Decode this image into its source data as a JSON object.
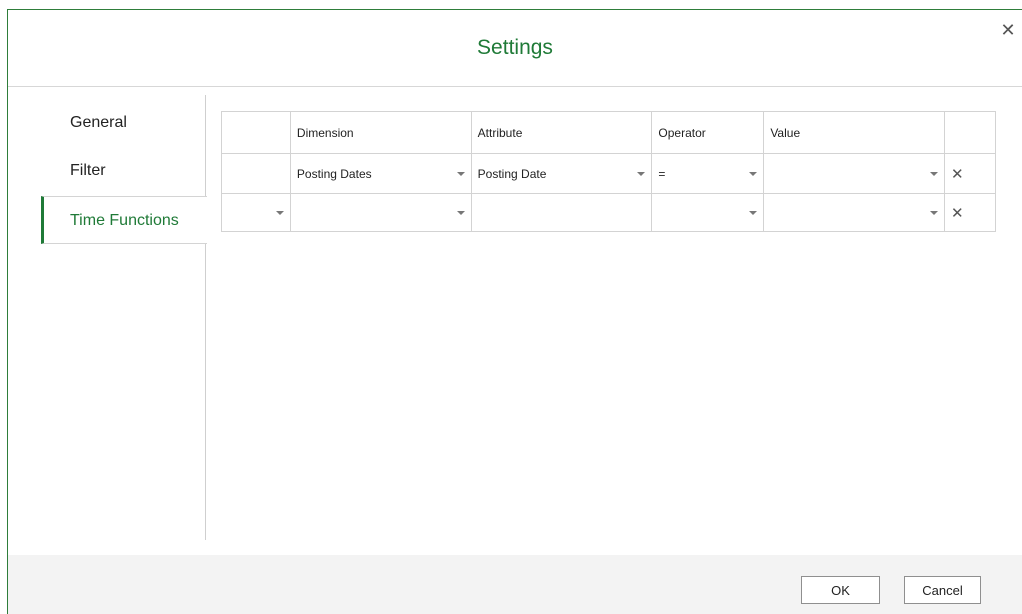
{
  "dialog": {
    "title": "Settings",
    "close_symbol": "✕"
  },
  "sidebar": {
    "tabs": [
      {
        "label": "General",
        "active": false
      },
      {
        "label": "Filter",
        "active": false
      },
      {
        "label": "Time Functions",
        "active": true
      }
    ]
  },
  "grid": {
    "headers": [
      "",
      "Dimension",
      "Attribute",
      "Operator",
      "Value",
      ""
    ],
    "rows": [
      {
        "lead": "",
        "dimension": "Posting Dates",
        "attribute": "Posting Date",
        "operator": "=",
        "value": "",
        "remove": "✕"
      },
      {
        "lead": "",
        "dimension": "",
        "attribute": "",
        "operator": "",
        "value": "",
        "remove": "✕"
      }
    ]
  },
  "footer": {
    "ok_label": "OK",
    "cancel_label": "Cancel"
  },
  "colors": {
    "accent": "#1f7a37",
    "footer_bg": "#f3f3f3"
  }
}
